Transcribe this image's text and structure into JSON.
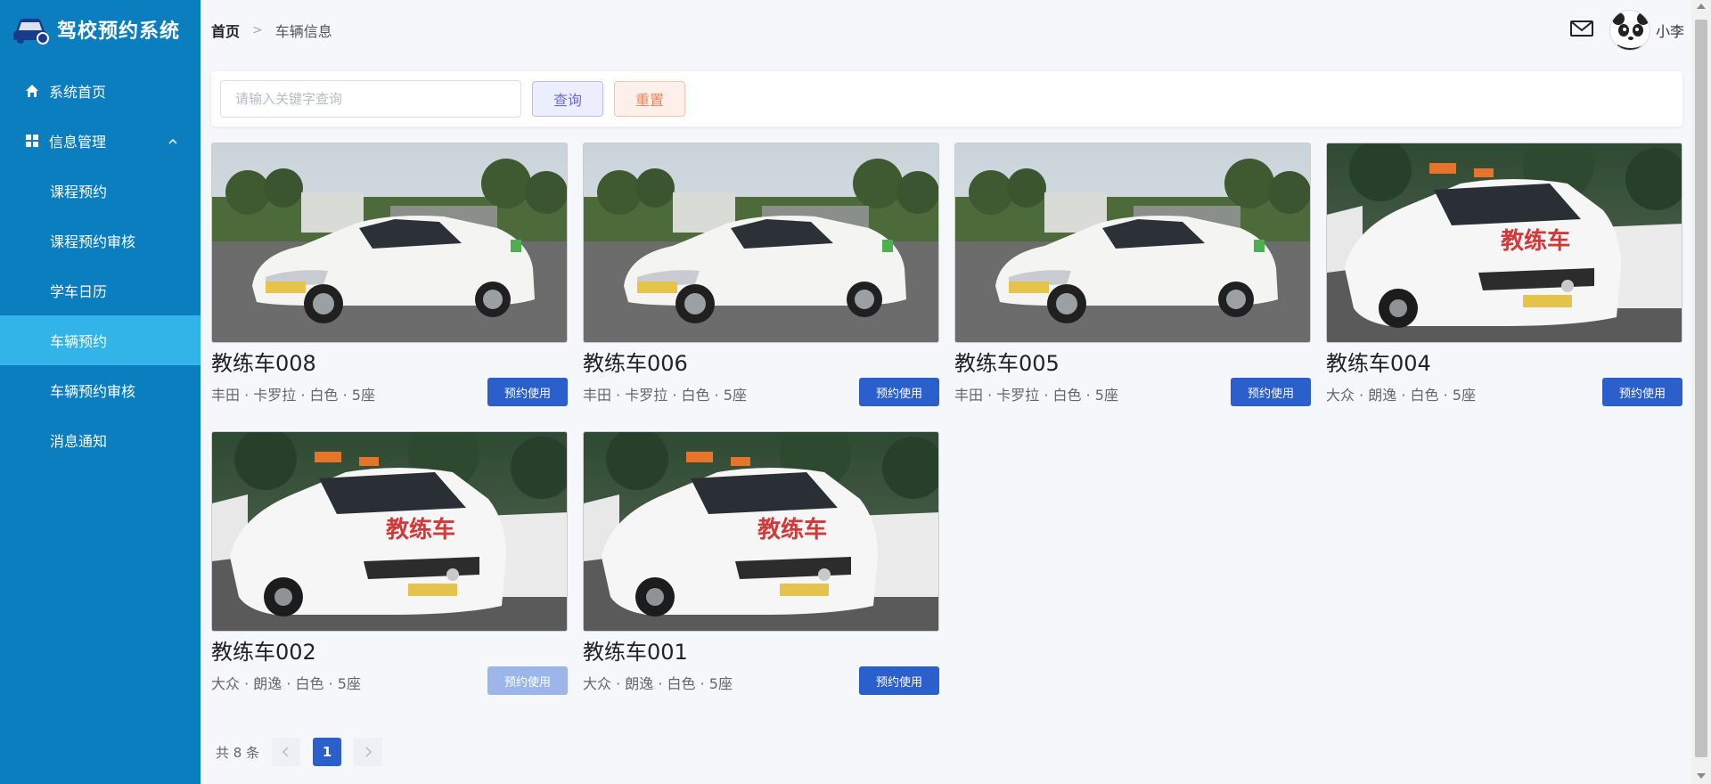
{
  "app": {
    "title": "驾校预约系统"
  },
  "sidebar": {
    "items": [
      {
        "label": "系统首页",
        "icon": "home-icon"
      },
      {
        "label": "信息管理",
        "icon": "grid-icon",
        "expanded": true
      }
    ],
    "submenu": [
      {
        "label": "课程预约",
        "active": false
      },
      {
        "label": "课程预约审核",
        "active": false
      },
      {
        "label": "学车日历",
        "active": false
      },
      {
        "label": "车辆预约",
        "active": true
      },
      {
        "label": "车辆预约审核",
        "active": false
      },
      {
        "label": "消息通知",
        "active": false
      }
    ]
  },
  "header": {
    "breadcrumb": {
      "home": "首页",
      "current": "车辆信息"
    },
    "user": {
      "name": "小李"
    }
  },
  "search": {
    "placeholder": "请输入关键字查询",
    "value": "",
    "query_label": "查询",
    "reset_label": "重置"
  },
  "cars": [
    {
      "name": "教练车008",
      "spec": "丰田 · 卡罗拉 · 白色 · 5座",
      "button": "预约使用",
      "disabled": false,
      "model": "toyota"
    },
    {
      "name": "教练车006",
      "spec": "丰田 · 卡罗拉 · 白色 · 5座",
      "button": "预约使用",
      "disabled": false,
      "model": "toyota"
    },
    {
      "name": "教练车005",
      "spec": "丰田 · 卡罗拉 · 白色 · 5座",
      "button": "预约使用",
      "disabled": false,
      "model": "toyota"
    },
    {
      "name": "教练车004",
      "spec": "大众 · 朗逸 · 白色 · 5座",
      "button": "预约使用",
      "disabled": false,
      "model": "vw"
    },
    {
      "name": "教练车002",
      "spec": "大众 · 朗逸 · 白色 · 5座",
      "button": "预约使用",
      "disabled": true,
      "model": "vw"
    },
    {
      "name": "教练车001",
      "spec": "大众 · 朗逸 · 白色 · 5座",
      "button": "预约使用",
      "disabled": false,
      "model": "vw"
    }
  ],
  "pagination": {
    "total_label": "共 8 条",
    "current_page": "1",
    "prev_icon": "chevron-left-icon",
    "next_icon": "chevron-right-icon"
  },
  "colors": {
    "sidebar": "#0b7ec0",
    "active_menu": "#32b4e8",
    "primary": "#2b5fcc"
  }
}
